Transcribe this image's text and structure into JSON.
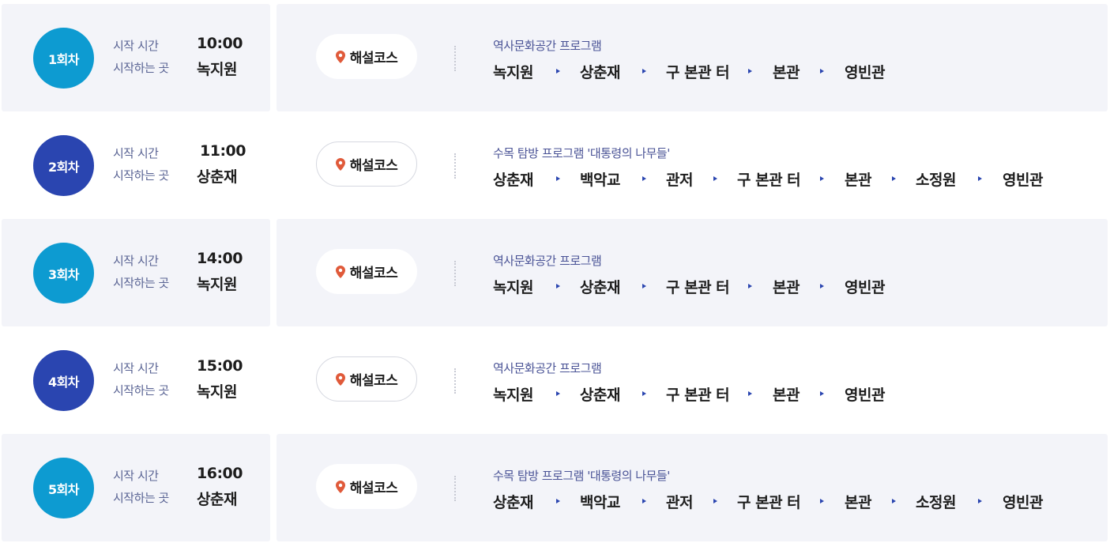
{
  "labels": {
    "start_time": "시작 시간",
    "start_place": "시작하는 곳",
    "course_button": "해설코스"
  },
  "colors": {
    "badge_cyan": "#0d9bd1",
    "badge_navy": "#2a45b0",
    "panel_shade": "#f3f4f9",
    "pin": "#e05a3a",
    "arrow": "#2a45b0"
  },
  "sessions": [
    {
      "badge": "1회차",
      "time": "10:00",
      "place": "녹지원",
      "program": "역사문화공간 프로그램",
      "stops": [
        "녹지원",
        "상춘재",
        "구 본관 터",
        "본관",
        "영빈관"
      ]
    },
    {
      "badge": "2회차",
      "time": "11:00",
      "place": "상춘재",
      "program": "수목 탐방 프로그램 '대통령의 나무들'",
      "stops": [
        "상춘재",
        "백악교",
        "관저",
        "구 본관 터",
        "본관",
        "소정원",
        "영빈관"
      ]
    },
    {
      "badge": "3회차",
      "time": "14:00",
      "place": "녹지원",
      "program": "역사문화공간 프로그램",
      "stops": [
        "녹지원",
        "상춘재",
        "구 본관 터",
        "본관",
        "영빈관"
      ]
    },
    {
      "badge": "4회차",
      "time": "15:00",
      "place": "녹지원",
      "program": "역사문화공간 프로그램",
      "stops": [
        "녹지원",
        "상춘재",
        "구 본관 터",
        "본관",
        "영빈관"
      ]
    },
    {
      "badge": "5회차",
      "time": "16:00",
      "place": "상춘재",
      "program": "수목 탐방 프로그램 '대통령의 나무들'",
      "stops": [
        "상춘재",
        "백악교",
        "관저",
        "구 본관 터",
        "본관",
        "소정원",
        "영빈관"
      ]
    }
  ]
}
